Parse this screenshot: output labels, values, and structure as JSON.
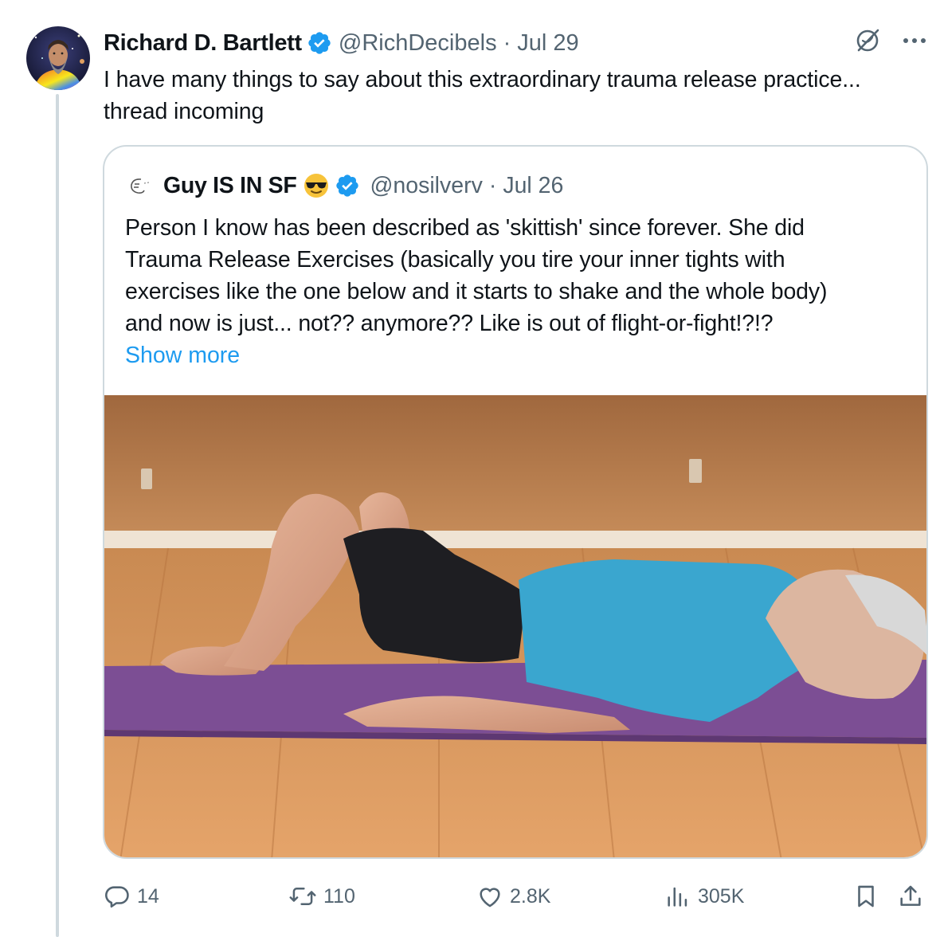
{
  "tweet": {
    "display_name": "Richard D. Bartlett",
    "handle": "@RichDecibels",
    "separator": "·",
    "date": "Jul 29",
    "text_line1": "I have many things to say about this extraordinary trauma release practice...",
    "text_line2": "thread incoming",
    "icons": {
      "avatar": "avatar-image",
      "verified": "verified-badge-icon",
      "grok": "grok-icon",
      "more": "more-icon"
    }
  },
  "quote": {
    "display_name": "Guy IS IN SF",
    "emoji": "sunglasses-emoji",
    "handle": "@nosilverv",
    "separator": "·",
    "date": "Jul 26",
    "lines": [
      "Person I know has been described as 'skittish' since forever. She did",
      "Trauma Release Exercises (basically you tire your inner tights with",
      "exercises like the one below and it starts to shake and the whole body)",
      "and now is just... not?? anymore?? Like is out of flight-or-fight!?!?"
    ],
    "show_more": "Show more",
    "media": "photo-man-lying-on-yoga-mat"
  },
  "actions": {
    "replies": "14",
    "reposts": "110",
    "likes": "2.8K",
    "views": "305K"
  },
  "colors": {
    "text": "#0f1419",
    "secondary": "#536471",
    "link": "#1d9bf0",
    "border": "#cfd9de",
    "thread_line": "#cfd9de"
  }
}
